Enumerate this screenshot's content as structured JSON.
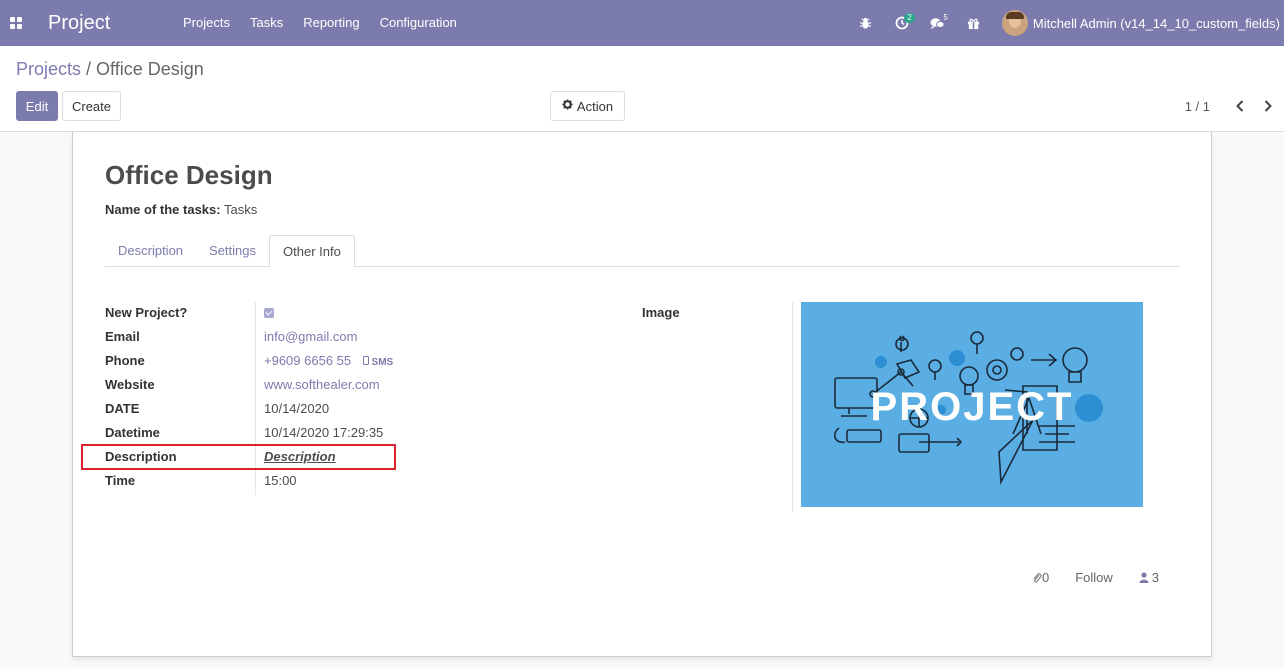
{
  "app": {
    "title": "Project"
  },
  "menu": [
    "Projects",
    "Tasks",
    "Reporting",
    "Configuration"
  ],
  "navbar": {
    "activity_count": "2",
    "message_count": "5",
    "user_name": "Mitchell Admin (v14_14_10_custom_fields)"
  },
  "breadcrumb": {
    "parent": "Projects",
    "separator": "/",
    "current": "Office Design"
  },
  "buttons": {
    "edit": "Edit",
    "create": "Create",
    "action": "Action"
  },
  "pager": {
    "text": "1 / 1"
  },
  "record": {
    "title": "Office Design",
    "tasks_label": "Name of the tasks:",
    "tasks_value": "Tasks"
  },
  "tabs": [
    {
      "label": "Description",
      "active": false
    },
    {
      "label": "Settings",
      "active": false
    },
    {
      "label": "Other Info",
      "active": true
    }
  ],
  "fields": {
    "new_project": {
      "label": "New Project?",
      "checked": true
    },
    "email": {
      "label": "Email",
      "value": "info@gmail.com"
    },
    "phone": {
      "label": "Phone",
      "value": "+9609 6656 55",
      "sms": "SMS"
    },
    "website": {
      "label": "Website",
      "value": "www.softhealer.com"
    },
    "date": {
      "label": "DATE",
      "value": "10/14/2020"
    },
    "datetime": {
      "label": "Datetime",
      "value": "10/14/2020 17:29:35"
    },
    "description": {
      "label": "Description",
      "value": "Description"
    },
    "time": {
      "label": "Time",
      "value": "15:00"
    },
    "image": {
      "label": "Image",
      "image_text": "PROJECT"
    }
  },
  "chatter": {
    "attachments": "0",
    "follow": "Follow",
    "followers": "3"
  },
  "colors": {
    "brand": "#7c7bad",
    "highlight": "#d9232e",
    "image_bg": "#5aaee3",
    "link_red": "#e0352b"
  }
}
